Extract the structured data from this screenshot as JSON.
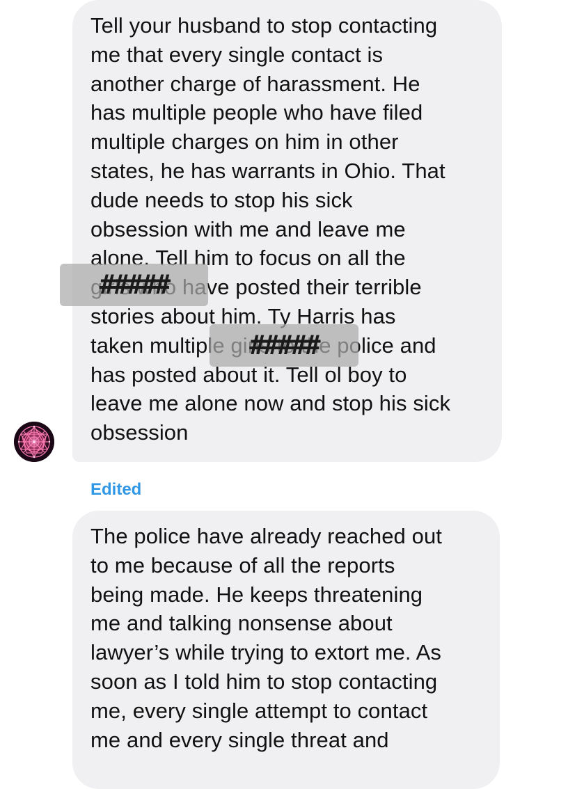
{
  "messages": [
    {
      "lines": [
        "Tell your husband to stop contacting",
        "me that every single contact is",
        "another charge of harassment. He",
        "has multiple people who have filed",
        "multiple charges on him in other",
        "states, he has warrants in Ohio. That",
        "dude needs to stop his sick",
        "obsession with me and leave me",
        "alone. Tell him to focus on all the",
        "girls who have posted their terrible",
        "stories about him. Ty Harris has",
        "taken multiple girls to the police and",
        "has posted about it. Tell ol boy to",
        "leave me alone now and stop his sick",
        "obsession"
      ]
    },
    {
      "lines": [
        "The police have already reached out",
        "to me because of all the reports",
        "being made. He keeps threatening",
        "me and talking nonsense about",
        "lawyer’s while trying to extort me. As",
        "soon as I told him to stop contacting",
        "me, every single attempt to contact",
        "me and every single threat and"
      ]
    }
  ],
  "redactions": [
    "#####",
    "#####"
  ],
  "edited_label": "Edited",
  "colors": {
    "bubble": "#f0f0f2",
    "edited": "#2f97e6",
    "text": "#111111"
  },
  "icons": {
    "avatar": "sacred-geometry-avatar-icon"
  }
}
